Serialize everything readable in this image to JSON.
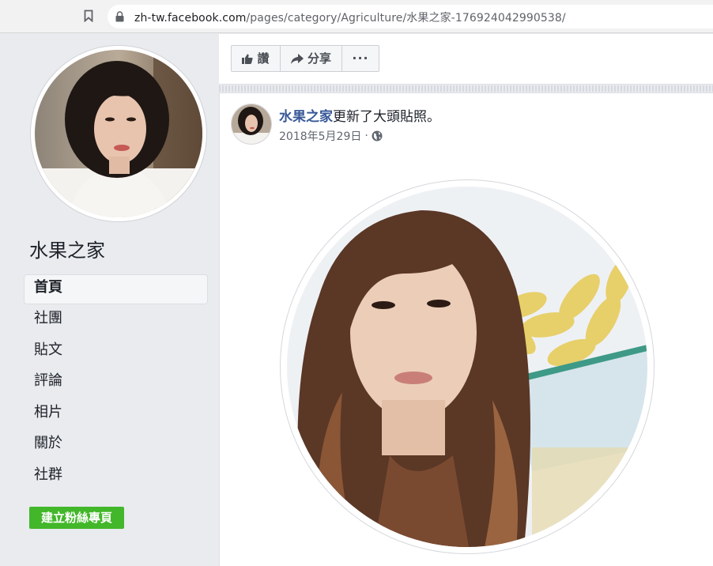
{
  "browser": {
    "url_host": "zh-tw.facebook.com",
    "url_path": "/pages/category/Agriculture/水果之家-176924042990538/"
  },
  "sidebar": {
    "page_name": "水果之家",
    "items": [
      {
        "label": "首頁",
        "active": true
      },
      {
        "label": "社團"
      },
      {
        "label": "貼文"
      },
      {
        "label": "評論"
      },
      {
        "label": "相片"
      },
      {
        "label": "關於"
      },
      {
        "label": "社群"
      }
    ],
    "create_page_label": "建立粉絲專頁"
  },
  "actions": {
    "like_label": "讚",
    "share_label": "分享",
    "more_label": "···"
  },
  "post": {
    "author": "水果之家",
    "action_text": "更新了大頭貼照。",
    "date": "2018年5月29日",
    "separator": "·"
  },
  "colors": {
    "brand_link": "#385898",
    "create_button": "#42b72a",
    "background": "#e9ebee"
  },
  "icons": {
    "bookmark": "bookmark-icon",
    "lock": "lock-icon",
    "like": "thumbs-up-icon",
    "share": "share-arrow-icon",
    "privacy": "globe-icon"
  }
}
